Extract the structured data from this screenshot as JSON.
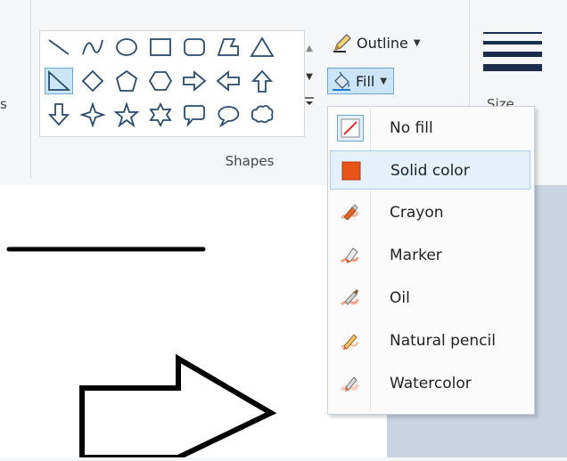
{
  "ribbon": {
    "left_partial_label": "s",
    "shapes_group_label": "Shapes",
    "outline_label": "Outline",
    "fill_label": "Fill",
    "size_label_partial": "Size"
  },
  "shapes": [
    "line",
    "curve",
    "oval",
    "rectangle",
    "rounded-rectangle",
    "polygon",
    "triangle",
    "right-triangle",
    "diamond",
    "pentagon",
    "hexagon",
    "right-arrow",
    "left-arrow",
    "up-arrow",
    "down-arrow",
    "four-point-star",
    "five-point-star",
    "six-point-star",
    "rounded-rectangular-callout",
    "oval-callout",
    "cloud-callout"
  ],
  "selected_shape": "right-triangle",
  "fill_menu": {
    "items": [
      {
        "label": "No fill",
        "icon": "no-fill-icon"
      },
      {
        "label": "Solid color",
        "icon": "solid-color-icon"
      },
      {
        "label": "Crayon",
        "icon": "crayon-icon"
      },
      {
        "label": "Marker",
        "icon": "marker-icon"
      },
      {
        "label": "Oil",
        "icon": "oil-icon"
      },
      {
        "label": "Natural pencil",
        "icon": "natural-pencil-icon"
      },
      {
        "label": "Watercolor",
        "icon": "watercolor-icon"
      }
    ],
    "highlighted": "Solid color"
  },
  "colors": {
    "accent_highlight": "#cce4f7",
    "solid_color_swatch": "#e8531c",
    "shape_stroke": "#000000",
    "line_width_color": "#1b2d4b"
  }
}
